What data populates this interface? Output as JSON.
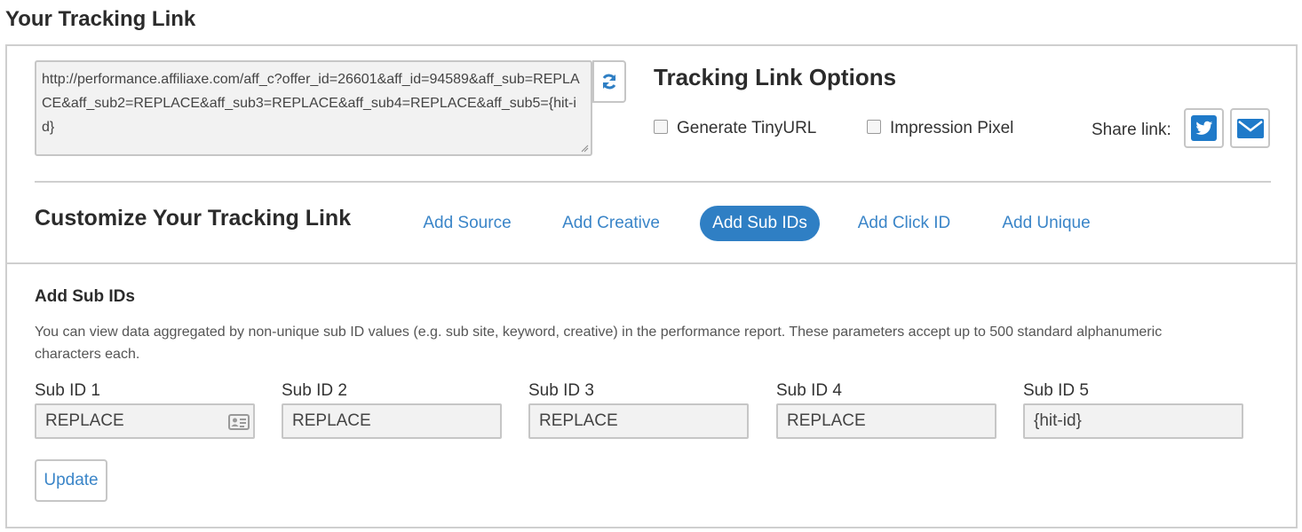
{
  "page": {
    "title": "Your Tracking Link"
  },
  "link": {
    "value": "http://performance.affiliaxe.com/aff_c?offer_id=26601&aff_id=94589&aff_sub=REPLACE&aff_sub2=REPLACE&aff_sub3=REPLACE&aff_sub4=REPLACE&aff_sub5={hit-id}",
    "refresh_icon": "refresh-icon"
  },
  "options": {
    "title": "Tracking Link Options",
    "generate_tinyurl": {
      "label": "Generate TinyURL",
      "checked": false
    },
    "impression_pixel": {
      "label": "Impression Pixel",
      "checked": false
    },
    "share_label": "Share link:",
    "share_icons": [
      "twitter-icon",
      "envelope-icon"
    ]
  },
  "customize": {
    "title": "Customize Your Tracking Link",
    "tabs": [
      {
        "label": "Add Source",
        "active": false
      },
      {
        "label": "Add Creative",
        "active": false
      },
      {
        "label": "Add Sub IDs",
        "active": true
      },
      {
        "label": "Add Click ID",
        "active": false
      },
      {
        "label": "Add Unique",
        "active": false
      }
    ]
  },
  "subids": {
    "title": "Add Sub IDs",
    "description": "You can view data aggregated by non-unique sub ID values (e.g. sub site, keyword, creative) in the performance report. These parameters accept up to 500 standard alphanumeric characters each.",
    "fields": [
      {
        "label": "Sub ID 1",
        "value": "REPLACE"
      },
      {
        "label": "Sub ID 2",
        "value": "REPLACE"
      },
      {
        "label": "Sub ID 3",
        "value": "REPLACE"
      },
      {
        "label": "Sub ID 4",
        "value": "REPLACE"
      },
      {
        "label": "Sub ID 5",
        "value": "{hit-id}"
      }
    ],
    "update_label": "Update"
  },
  "colors": {
    "accent": "#2f7fc4",
    "link": "#3a85c8",
    "border": "#c6c6c6",
    "input_bg": "#f2f2f2"
  }
}
